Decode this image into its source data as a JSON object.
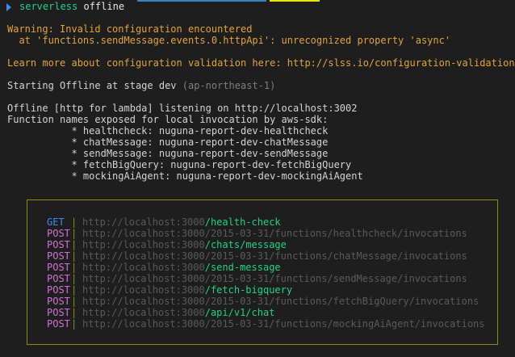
{
  "prompt": {
    "command": "serverless",
    "argument": "offline"
  },
  "warning": {
    "title": "Warning: Invalid configuration encountered",
    "detail": "  at 'functions.sendMessage.events.0.httpApi': unrecognized property 'async'",
    "learn_more": "Learn more about configuration validation here: http://slss.io/configuration-validation"
  },
  "starting": {
    "text": "Starting Offline at stage dev ",
    "region": "(ap-northeast-1)"
  },
  "offline": {
    "listening": "Offline [http for lambda] listening on http://localhost:3002",
    "functions_header": "Function names exposed for local invocation by aws-sdk:",
    "functions": [
      "           * healthcheck: nuguna-report-dev-healthcheck",
      "           * chatMessage: nuguna-report-dev-chatMessage",
      "           * sendMessage: nuguna-report-dev-sendMessage",
      "           * fetchBigQuery: nuguna-report-dev-fetchBigQuery",
      "           * mockingAiAgent: nuguna-report-dev-mockingAiAgent"
    ]
  },
  "routes": {
    "separator": "|",
    "items": [
      {
        "method": "GET",
        "host": "http://localhost:3000",
        "path": "/health-check",
        "highlight": true
      },
      {
        "method": "POST",
        "host": "http://localhost:3000",
        "path": "/2015-03-31/functions/healthcheck/invocations",
        "highlight": false
      },
      {
        "method": "POST",
        "host": "http://localhost:3000",
        "path": "/chats/message",
        "highlight": true
      },
      {
        "method": "POST",
        "host": "http://localhost:3000",
        "path": "/2015-03-31/functions/chatMessage/invocations",
        "highlight": false
      },
      {
        "method": "POST",
        "host": "http://localhost:3000",
        "path": "/send-message",
        "highlight": true
      },
      {
        "method": "POST",
        "host": "http://localhost:3000",
        "path": "/2015-03-31/functions/sendMessage/invocations",
        "highlight": false
      },
      {
        "method": "POST",
        "host": "http://localhost:3000",
        "path": "/fetch-bigquery",
        "highlight": true
      },
      {
        "method": "POST",
        "host": "http://localhost:3000",
        "path": "/2015-03-31/functions/fetchBigQuery/invocations",
        "highlight": false
      },
      {
        "method": "POST",
        "host": "http://localhost:3000",
        "path": "/api/v1/chat",
        "highlight": true
      },
      {
        "method": "POST",
        "host": "http://localhost:3000",
        "path": "/2015-03-31/functions/mockingAiAgent/invocations",
        "highlight": false
      }
    ]
  },
  "colors": {
    "background": "#1e1e1e",
    "command_green": "#23d18b",
    "warning_orange": "#e3a43c",
    "method_get": "#3b8eea",
    "method_post": "#d670d6",
    "box_border": "#8c8c1c"
  }
}
